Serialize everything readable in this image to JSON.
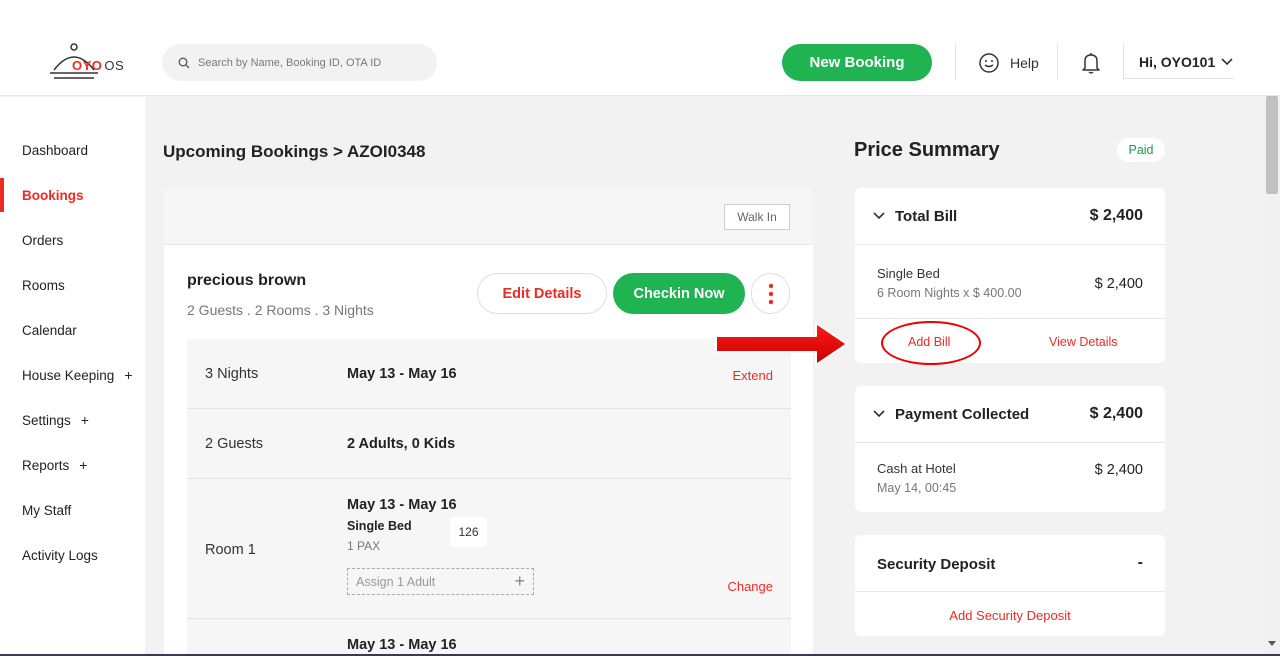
{
  "header": {
    "logo_brand": "OYO",
    "logo_suffix": "OS",
    "search_placeholder": "Search by Name, Booking ID, OTA ID",
    "new_booking_label": "New Booking",
    "help_label": "Help",
    "user_label": "Hi, OYO101"
  },
  "sidebar": {
    "items": [
      {
        "label": "Dashboard",
        "plus": ""
      },
      {
        "label": "Bookings",
        "plus": ""
      },
      {
        "label": "Orders",
        "plus": ""
      },
      {
        "label": "Rooms",
        "plus": ""
      },
      {
        "label": "Calendar",
        "plus": ""
      },
      {
        "label": "House Keeping",
        "plus": "+"
      },
      {
        "label": "Settings",
        "plus": "+"
      },
      {
        "label": "Reports",
        "plus": "+"
      },
      {
        "label": "My Staff",
        "plus": ""
      },
      {
        "label": "Activity Logs",
        "plus": ""
      }
    ],
    "active_index": 1
  },
  "main": {
    "breadcrumb": "Upcoming Bookings > AZOI0348",
    "walk_in_label": "Walk In",
    "guest_name": "precious brown",
    "guest_summary": "2 Guests . 2 Rooms . 3 Nights",
    "edit_details_label": "Edit Details",
    "checkin_now_label": "Checkin Now",
    "rows": {
      "nights": {
        "label": "3 Nights",
        "value": "May 13 - May 16",
        "action": "Extend"
      },
      "guests": {
        "label": "2 Guests",
        "value": "2 Adults, 0 Kids"
      },
      "room1": {
        "label": "Room 1",
        "dates": "May 13 - May 16",
        "room_type": "Single Bed",
        "pax": "1 PAX",
        "room_number": "126",
        "assign_placeholder": "Assign 1 Adult",
        "assign_plus": "+",
        "action": "Change"
      },
      "room2": {
        "dates": "May 13 - May 16"
      }
    }
  },
  "price_summary": {
    "title": "Price Summary",
    "status": "Paid",
    "total_bill": {
      "label": "Total Bill",
      "amount": "$ 2,400",
      "line_title": "Single Bed",
      "line_sub": "6 Room Nights x $ 400.00",
      "line_amount": "$ 2,400",
      "add_bill_label": "Add Bill",
      "view_details_label": "View Details"
    },
    "payment_collected": {
      "label": "Payment Collected",
      "amount": "$ 2,400",
      "line_title": "Cash at Hotel",
      "line_sub": "May 14, 00:45",
      "line_amount": "$ 2,400"
    },
    "security_deposit": {
      "label": "Security Deposit",
      "amount": "-",
      "add_label": "Add Security Deposit"
    }
  },
  "colors": {
    "brand_red": "#ee2a24",
    "action_green": "#1fb351",
    "annotation_red": "#e00000"
  }
}
